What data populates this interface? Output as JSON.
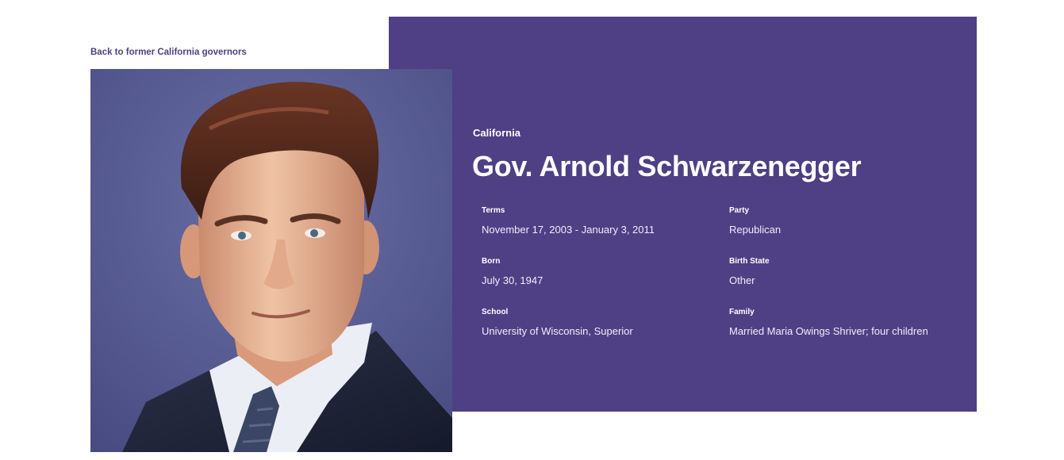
{
  "nav": {
    "back_link": "Back to former California governors"
  },
  "profile": {
    "state": "California",
    "name": "Gov. Arnold Schwarzenegger",
    "portrait_alt": "Gov. Arnold Schwarzenegger"
  },
  "details": {
    "terms": {
      "label": "Terms",
      "value": "November 17, 2003 - January 3, 2011"
    },
    "party": {
      "label": "Party",
      "value": "Republican"
    },
    "born": {
      "label": "Born",
      "value": "July 30, 1947"
    },
    "birth_state": {
      "label": "Birth State",
      "value": "Other"
    },
    "school": {
      "label": "School",
      "value": "University of Wisconsin, Superior"
    },
    "family": {
      "label": "Family",
      "value": "Married Maria Owings Shriver; four children"
    }
  },
  "colors": {
    "panel": "#4f3f85",
    "link": "#4f3f85",
    "text_on_panel": "#ffffff"
  }
}
